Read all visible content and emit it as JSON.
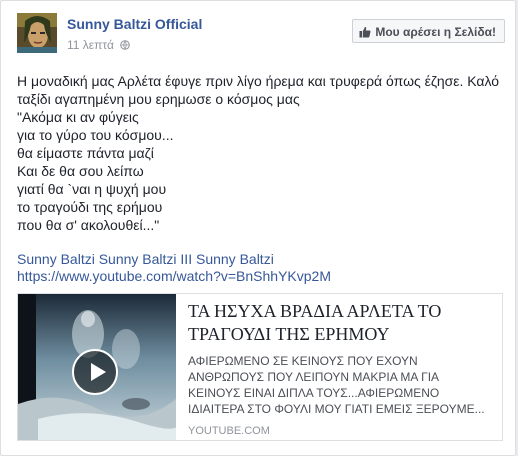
{
  "header": {
    "page_name": "Sunny Baltzi Official",
    "time": "11 λεπτά",
    "like_button": "Μου αρέσει η Σελίδα!"
  },
  "post": {
    "text": "Η μοναδική μας Αρλέτα έφυγε πριν λίγο ήρεμα και τρυφερά όπως έζησε. Καλό ταξίδι αγαπημένη μου ερημωσε ο κόσμος μας\n\"Ακόμα κι αν φύγεις\nγια το γύρο του κόσμου...\nθα είμαστε πάντα μαζί\nΚαι δε θα σου λείπω\nγιατί θα `ναι η ψυχή μου\nτο τραγούδι της ερήμου\nπου θα σ' ακολουθεί...\"",
    "tags": "Sunny Baltzi Sunny Baltzi III Sunny Baltzi",
    "url": "https://www.youtube.com/watch?v=BnShhYKvp2M"
  },
  "link_preview": {
    "title": "ΤΑ ΗΣΥΧΑ ΒΡΑΔΙΑ ΑΡΛΕΤΑ ΤΟ ΤΡΑΓΟΥΔΙ ΤΗΣ ΕΡΗΜΟΥ",
    "description": "ΑΦΙΕΡΩΜΕΝΟ ΣΕ ΚΕΙΝΟΥΣ ΠΟΥ ΕΧΟΥΝ ΑΝΘΡΩΠΟΥΣ ΠΟΥ ΛΕΙΠΟΥΝ ΜΑΚΡΙΑ ΜΑ ΓΙΑ ΚΕΙΝΟΥΣ ΕΙΝΑΙ ΔΙΠΛΑ ΤΟΥΣ...ΑΦΙΕΡΩΜΕΝΟ ΙΔΙΑΙΤΕΡΑ ΣΤΟ ΦΟΥΛΙ ΜΟΥ ΓΙΑΤΙ ΕΜΕΙΣ ΞΕΡΟΥΜΕ...",
    "source": "YOUTUBE.COM"
  },
  "icons": {
    "globe": "globe-icon",
    "thumb": "thumbs-up-icon",
    "play": "play-icon"
  },
  "colors": {
    "link": "#365899",
    "muted": "#90949c",
    "text": "#1d2129"
  }
}
